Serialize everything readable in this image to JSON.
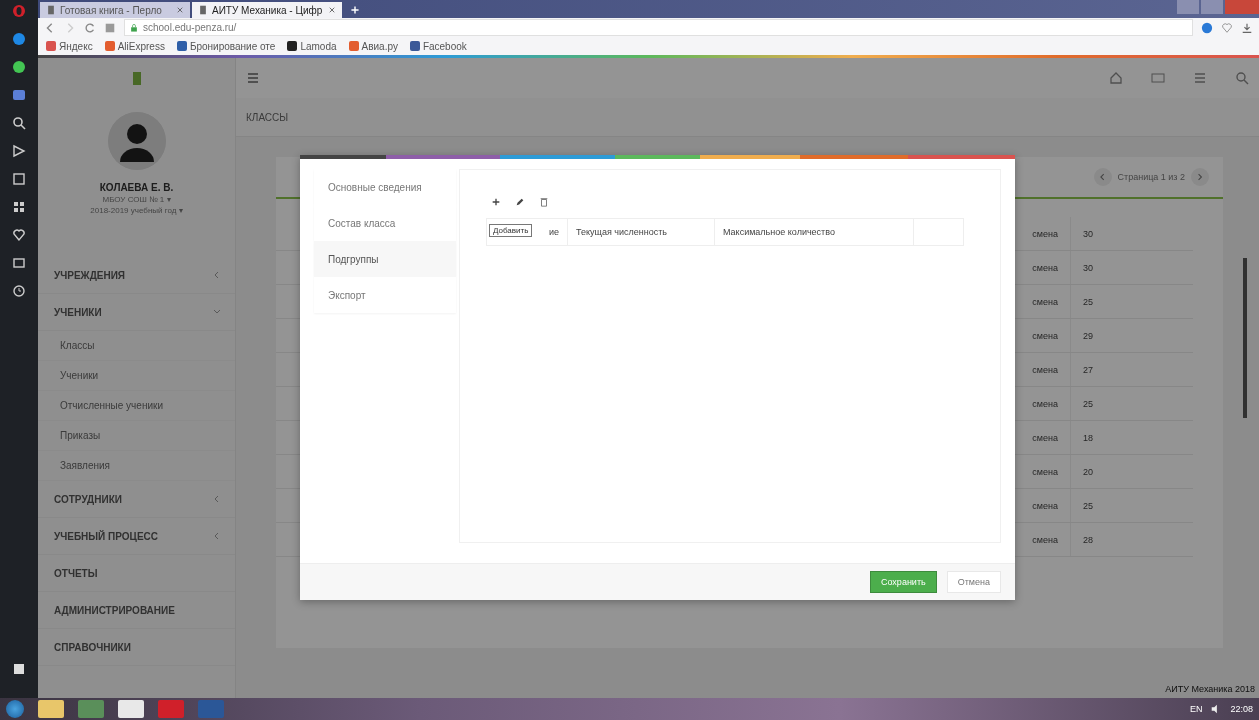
{
  "browser": {
    "tabs": [
      {
        "title": "Готовая книга - Перло",
        "selected": false
      },
      {
        "title": "АИТУ Механика - Цифр",
        "selected": true
      }
    ],
    "address": "school.edu-penza.ru/",
    "bookmarks": [
      "Яндекс",
      "AliExpress",
      "Бронирование оте",
      "Lamoda",
      "Авиа.ру",
      "Facebook"
    ]
  },
  "app": {
    "user": {
      "name": "КОЛАЕВА Е. В.",
      "org": "МБОУ СОШ № 1 ▾",
      "year": "2018-2019 учебный год ▾"
    },
    "menu": [
      {
        "label": "УЧРЕЖДЕНИЯ",
        "expanded": false
      },
      {
        "label": "УЧЕНИКИ",
        "expanded": true,
        "children": [
          "Классы",
          "Ученики",
          "Отчисленные ученики",
          "Приказы",
          "Заявления"
        ]
      },
      {
        "label": "СОТРУДНИКИ",
        "expanded": false
      },
      {
        "label": "УЧЕБНЫЙ ПРОЦЕСС",
        "expanded": false
      },
      {
        "label": "ОТЧЕТЫ"
      },
      {
        "label": "АДМИНИСТРИРОВАНИЕ"
      },
      {
        "label": "СПРАВОЧНИКИ"
      }
    ],
    "breadcrumb": "КЛАССЫ",
    "pager": "Страница 1 из 2",
    "rows": [
      {
        "shift": "смена",
        "count": "30"
      },
      {
        "shift": "смена",
        "count": "30"
      },
      {
        "shift": "смена",
        "count": "25"
      },
      {
        "shift": "смена",
        "count": "29"
      },
      {
        "shift": "смена",
        "count": "27"
      },
      {
        "shift": "смена",
        "count": "25"
      },
      {
        "shift": "смена",
        "count": "18"
      },
      {
        "shift": "смена",
        "count": "20"
      },
      {
        "shift": "смена",
        "count": "25"
      },
      {
        "shift": "смена",
        "count": "28"
      }
    ],
    "footer": "АИТУ Механика 2018"
  },
  "modal": {
    "tabs": [
      {
        "label": "Основные сведения",
        "selected": false
      },
      {
        "label": "Состав класса",
        "selected": false
      },
      {
        "label": "Подгруппы",
        "selected": true
      },
      {
        "label": "Экспорт",
        "selected": false
      }
    ],
    "columns": [
      "ие",
      "Текущая численность",
      "Максимальное количество"
    ],
    "tooltip": "Добавить",
    "buttons": [
      {
        "label": "Сохранить",
        "kind": "primary"
      },
      {
        "label": "Отмена",
        "kind": "secondary"
      }
    ]
  },
  "taskbar": {
    "language": "EN",
    "time": "22:08"
  }
}
